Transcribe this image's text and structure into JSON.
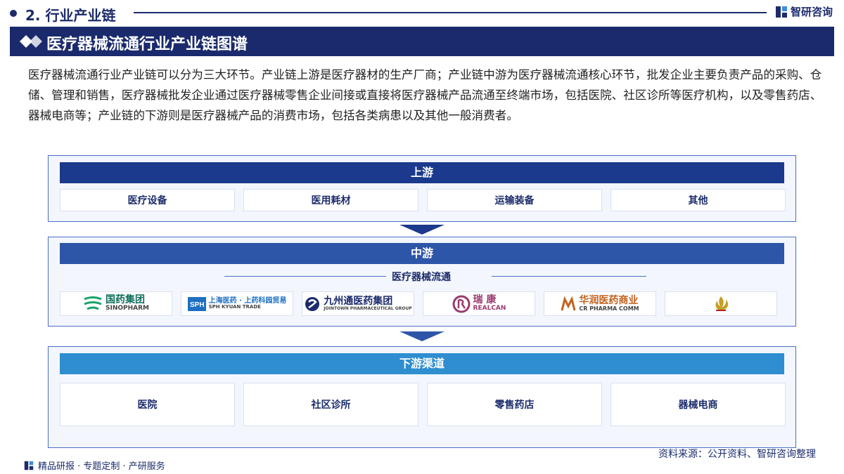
{
  "header": {
    "section_label": "2. 行业产业链",
    "brand_name": "智研咨询"
  },
  "title": "医疗器械流通行业产业链图谱",
  "paragraph": "医疗器械流通行业产业链可以分为三大环节。产业链上游是医疗器材的生产厂商；产业链中游为医疗器械流通核心环节，批发企业主要负责产品的采购、仓储、管理和销售，医疗器械批发企业通过医疗器械零售企业间接或直接将医疗器械产品流通至终端市场，包括医院、社区诊所等医疗机构，以及零售药店、器械电商等；产业链的下游则是医疗器械产品的消费市场，包括各类病患以及其他一般消费者。",
  "upstream": {
    "title": "上游",
    "items": [
      "医疗设备",
      "医用耗材",
      "运输装备",
      "其他"
    ]
  },
  "midstream": {
    "title": "中游",
    "subtitle": "医疗器械流通",
    "logos": [
      {
        "name": "国药集团",
        "sub": "SINOPHARM",
        "color": "#0f6f5c"
      },
      {
        "name": "上海医药 · 上药科园贸易",
        "sub": "SPH KYUAN TRADE",
        "color": "#1e6fc2"
      },
      {
        "name": "九州通医药集团",
        "sub": "JOINTOWN PHARMACEUTICAL GROUP",
        "color": "#1b2a6c"
      },
      {
        "name": "瑞 康",
        "sub": "REALCAN",
        "color": "#9a3b6e"
      },
      {
        "name": "华润医药商业",
        "sub": "CR PHARMA COMM",
        "color": "#c2611c"
      },
      {
        "name": "",
        "sub": "",
        "color": "#c5a024"
      }
    ]
  },
  "downstream": {
    "title": "下游渠道",
    "items": [
      "医院",
      "社区诊所",
      "零售药店",
      "器械电商"
    ]
  },
  "footer": {
    "left": "精品研报 · 专题定制 · 产研服务",
    "source": "资料来源：公开资料、智研咨询整理"
  }
}
